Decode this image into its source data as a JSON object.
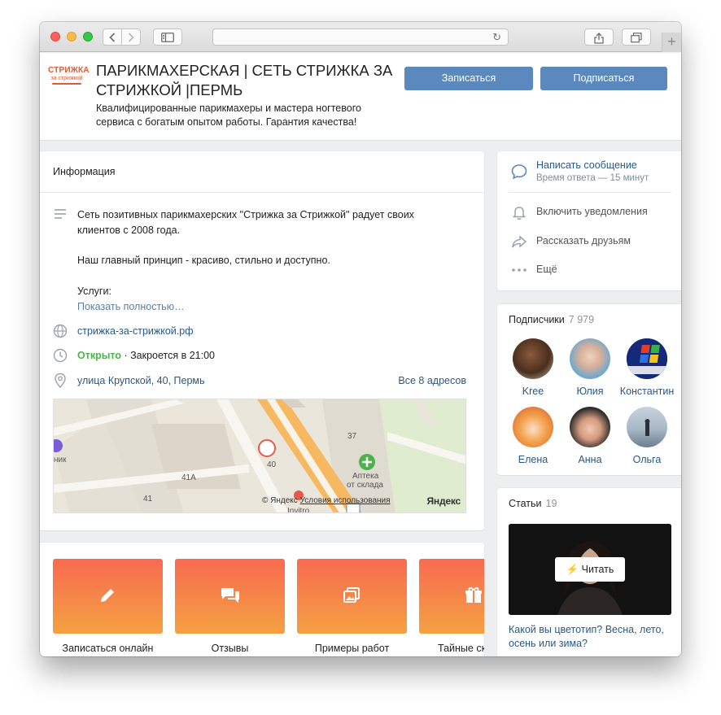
{
  "browser": {
    "address": "",
    "new_tab_label": "+"
  },
  "group": {
    "logo_line1": "СТРИЖКА",
    "logo_line2": "за стрижкой",
    "title": "ПАРИКМАХЕРСКАЯ | СЕТЬ СТРИЖКА ЗА СТРИЖКОЙ |ПЕРМЬ",
    "description": "Квалифицированные парикмахеры и мастера ногтевого сервиса с богатым опытом работы. Гарантия качества!",
    "book_button": "Записаться",
    "subscribe_button": "Подписаться"
  },
  "info": {
    "heading": "Информация",
    "paragraph1": "Сеть позитивных парикмахерских \"Стрижка за Стрижкой\" радует своих клиентов с 2008 года.",
    "paragraph2": "Наш главный принцип - красиво, стильно и доступно.",
    "paragraph3": "Услуги:",
    "show_more": "Показать полностью…",
    "website": "стрижка-за-стрижкой.рф",
    "open_status": "Открыто",
    "closes": " · Закроется в 21:00",
    "address": "улица Крупской, 40, Пермь",
    "all_addresses": "Все 8 адресов"
  },
  "map": {
    "labels": [
      "41",
      "41А",
      "40",
      "37",
      "Аптека",
      "от склада",
      "ник",
      "Invitro"
    ],
    "copyright": "© Яндекс",
    "terms": "Условия использования",
    "logo": "Яндекс"
  },
  "apps": [
    {
      "label": "Записаться онлайн",
      "icon": "pencil-icon"
    },
    {
      "label": "Отзывы",
      "icon": "chat-icon"
    },
    {
      "label": "Примеры работ",
      "icon": "gallery-icon"
    },
    {
      "label": "Тайные ск",
      "icon": "gift-icon"
    }
  ],
  "actions": {
    "message": "Написать сообщение",
    "response_time": "Время ответа — 15 минут",
    "notifications": "Включить уведомления",
    "share": "Рассказать друзьям",
    "more": "Ещё"
  },
  "subscribers": {
    "heading": "Подписчики",
    "count": "7 979",
    "people": [
      "Kree",
      "Юлия",
      "Константин",
      "Елена",
      "Анна",
      "Ольга"
    ]
  },
  "articles": {
    "heading": "Статьи",
    "count": "19",
    "read_button": "Читать",
    "article_title": "Какой вы цветотип? Весна, лето, осень или зима?"
  },
  "colors": {
    "accent_blue": "#5b88bd",
    "link": "#2a5885",
    "open_green": "#4bb34b",
    "tile_top": "#f86a51",
    "tile_bottom": "#f4a142"
  }
}
